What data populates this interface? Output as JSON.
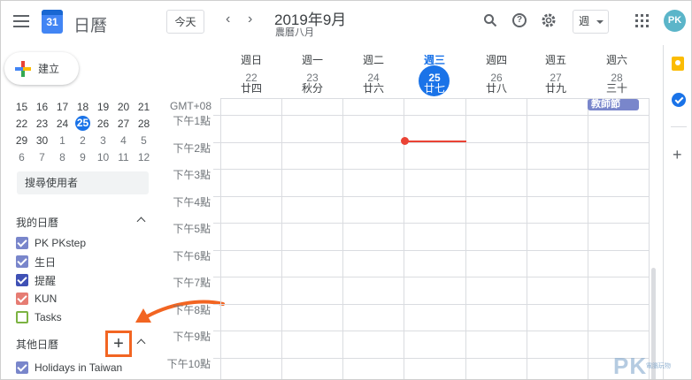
{
  "header": {
    "app_title": "日曆",
    "logo_day": "31",
    "today_label": "今天",
    "nav_prev": "‹",
    "nav_next": "›",
    "date_title": "2019年9月",
    "lunar_title": "農曆八月",
    "view_label": "週",
    "avatar_initials": "PK"
  },
  "sidebar": {
    "create_label": "建立",
    "mini_calendar": [
      [
        {
          "d": "15"
        },
        {
          "d": "16"
        },
        {
          "d": "17"
        },
        {
          "d": "18"
        },
        {
          "d": "19"
        },
        {
          "d": "20"
        },
        {
          "d": "21"
        }
      ],
      [
        {
          "d": "22"
        },
        {
          "d": "23"
        },
        {
          "d": "24"
        },
        {
          "d": "25",
          "today": true
        },
        {
          "d": "26"
        },
        {
          "d": "27"
        },
        {
          "d": "28"
        }
      ],
      [
        {
          "d": "29"
        },
        {
          "d": "30"
        },
        {
          "d": "1",
          "other": true
        },
        {
          "d": "2",
          "other": true
        },
        {
          "d": "3",
          "other": true
        },
        {
          "d": "4",
          "other": true
        },
        {
          "d": "5",
          "other": true
        }
      ],
      [
        {
          "d": "6",
          "other": true
        },
        {
          "d": "7",
          "other": true
        },
        {
          "d": "8",
          "other": true
        },
        {
          "d": "9",
          "other": true
        },
        {
          "d": "10",
          "other": true
        },
        {
          "d": "11",
          "other": true
        },
        {
          "d": "12",
          "other": true
        }
      ]
    ],
    "search_users_placeholder": "搜尋使用者",
    "my_calendars_title": "我的日曆",
    "my_calendars": [
      {
        "label": "PK PKstep",
        "color": "#7986cb",
        "checked": true
      },
      {
        "label": "生日",
        "color": "#7986cb",
        "checked": true
      },
      {
        "label": "提醒",
        "color": "#3f51b5",
        "checked": true
      },
      {
        "label": "KUN",
        "color": "#e67c73",
        "checked": true
      },
      {
        "label": "Tasks",
        "color": "#7cb342",
        "checked": false
      }
    ],
    "other_calendars_title": "其他日曆",
    "add_other_label": "+",
    "other_calendars": [
      {
        "label": "Holidays in Taiwan",
        "color": "#7986cb",
        "checked": true
      }
    ]
  },
  "week": {
    "timezone_label": "GMT+08",
    "days": [
      {
        "name": "週日",
        "num": "22",
        "lunar": "廿四",
        "today": false
      },
      {
        "name": "週一",
        "num": "23",
        "lunar": "秋分",
        "today": false
      },
      {
        "name": "週二",
        "num": "24",
        "lunar": "廿六",
        "today": false
      },
      {
        "name": "週三",
        "num": "25",
        "lunar": "廿七",
        "today": true
      },
      {
        "name": "週四",
        "num": "26",
        "lunar": "廿八",
        "today": false
      },
      {
        "name": "週五",
        "num": "27",
        "lunar": "廿九",
        "today": false
      },
      {
        "name": "週六",
        "num": "28",
        "lunar": "三十",
        "today": false
      }
    ],
    "hours": [
      "下午1點",
      "下午2點",
      "下午3點",
      "下午4點",
      "下午5點",
      "下午6點",
      "下午7點",
      "下午8點",
      "下午9點",
      "下午10點"
    ],
    "all_day_event": "教師節"
  },
  "colors": {
    "accent": "#1a73e8",
    "now_indicator": "#ea4335",
    "annotation": "#f26522"
  },
  "watermark": {
    "text": "PK",
    "sub": "電腦玩物"
  }
}
